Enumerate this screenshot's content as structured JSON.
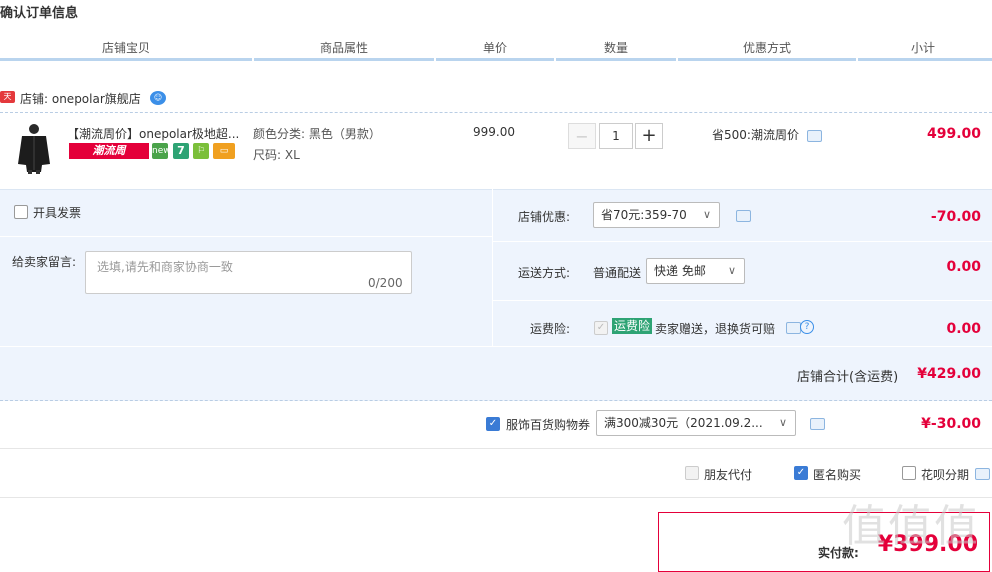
{
  "title": "确认订单信息",
  "headers": [
    "店铺宝贝",
    "商品属性",
    "单价",
    "数量",
    "优惠方式",
    "小计"
  ],
  "shop": {
    "badge": "天猫",
    "label": "店铺: onepolar旗舰店"
  },
  "item": {
    "name": "【潮流周价】onepolar极地超...",
    "promo_banner": "潮流周",
    "attr_color": "颜色分类: 黑色（男款）",
    "attr_size": "尺码: XL",
    "price": "999.00",
    "qty_minus": "−",
    "qty": "1",
    "qty_plus": "+",
    "discount": "省500:潮流周价",
    "subtotal": "499.00",
    "service_icons": [
      "new",
      "7",
      "assured",
      "card"
    ]
  },
  "invoice_label": "开具发票",
  "message": {
    "label": "给卖家留言:",
    "placeholder": "选填,请先和商家协商一致",
    "counter": "0/200"
  },
  "shop_discount": {
    "label": "店铺优惠:",
    "selected": "省70元:359-70",
    "amount": "-70.00"
  },
  "shipping": {
    "label": "运送方式:",
    "method": "普通配送",
    "selected": "快递 免邮",
    "amount": "0.00"
  },
  "insurance": {
    "label": "运费险:",
    "tag": "运费险",
    "desc": "卖家赠送，退换货可赔",
    "amount": "0.00"
  },
  "shop_total": {
    "label": "店铺合计(含运费)",
    "amount": "¥429.00"
  },
  "coupon": {
    "label": "服饰百货购物券",
    "selected": "满300减30元（2021.09.2...",
    "amount": "¥-30.00"
  },
  "options": [
    {
      "label": "朋友代付",
      "checked": false,
      "disabled": true
    },
    {
      "label": "匿名购买",
      "checked": true,
      "disabled": false
    },
    {
      "label": "花呗分期",
      "checked": false,
      "disabled": false
    }
  ],
  "final": {
    "label": "实付款:",
    "amount": "¥399.00"
  },
  "watermark": "值值值",
  "colors": {
    "accent": "#e4003a",
    "panel": "#eef4fd",
    "link": "#3a7bd5"
  }
}
